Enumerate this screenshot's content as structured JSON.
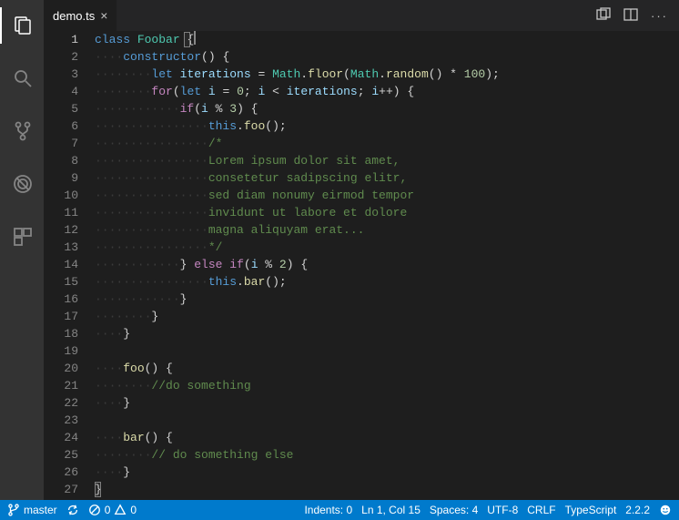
{
  "tabs": {
    "active": {
      "filename": "demo.ts"
    }
  },
  "code": {
    "lines": [
      [
        {
          "c": "kw",
          "t": "class"
        },
        {
          "c": "pln",
          "t": " "
        },
        {
          "c": "cls",
          "t": "Foobar"
        },
        {
          "c": "pln",
          "t": " {"
        }
      ],
      [
        {
          "c": "ws",
          "t": "····"
        },
        {
          "c": "kw",
          "t": "constructor"
        },
        {
          "c": "pln",
          "t": "() {"
        }
      ],
      [
        {
          "c": "ws",
          "t": "········"
        },
        {
          "c": "kw",
          "t": "let"
        },
        {
          "c": "pln",
          "t": " "
        },
        {
          "c": "ident",
          "t": "iterations"
        },
        {
          "c": "pln",
          "t": " = "
        },
        {
          "c": "cls",
          "t": "Math"
        },
        {
          "c": "pln",
          "t": "."
        },
        {
          "c": "fn",
          "t": "floor"
        },
        {
          "c": "pln",
          "t": "("
        },
        {
          "c": "cls",
          "t": "Math"
        },
        {
          "c": "pln",
          "t": "."
        },
        {
          "c": "fn",
          "t": "random"
        },
        {
          "c": "pln",
          "t": "() * "
        },
        {
          "c": "num",
          "t": "100"
        },
        {
          "c": "pln",
          "t": ");"
        }
      ],
      [
        {
          "c": "ws",
          "t": "········"
        },
        {
          "c": "kw2",
          "t": "for"
        },
        {
          "c": "pln",
          "t": "("
        },
        {
          "c": "kw",
          "t": "let"
        },
        {
          "c": "pln",
          "t": " "
        },
        {
          "c": "ident",
          "t": "i"
        },
        {
          "c": "pln",
          "t": " = "
        },
        {
          "c": "num",
          "t": "0"
        },
        {
          "c": "pln",
          "t": "; "
        },
        {
          "c": "ident",
          "t": "i"
        },
        {
          "c": "pln",
          "t": " < "
        },
        {
          "c": "ident",
          "t": "iterations"
        },
        {
          "c": "pln",
          "t": "; "
        },
        {
          "c": "ident",
          "t": "i"
        },
        {
          "c": "pln",
          "t": "++) {"
        }
      ],
      [
        {
          "c": "ws",
          "t": "············"
        },
        {
          "c": "kw2",
          "t": "if"
        },
        {
          "c": "pln",
          "t": "("
        },
        {
          "c": "ident",
          "t": "i"
        },
        {
          "c": "pln",
          "t": " % "
        },
        {
          "c": "num",
          "t": "3"
        },
        {
          "c": "pln",
          "t": ") {"
        }
      ],
      [
        {
          "c": "ws",
          "t": "················"
        },
        {
          "c": "tok-this",
          "t": "this"
        },
        {
          "c": "pln",
          "t": "."
        },
        {
          "c": "fn",
          "t": "foo"
        },
        {
          "c": "pln",
          "t": "();"
        }
      ],
      [
        {
          "c": "ws",
          "t": "················"
        },
        {
          "c": "cmt",
          "t": "/*"
        }
      ],
      [
        {
          "c": "ws",
          "t": "················"
        },
        {
          "c": "cmt",
          "t": "Lorem ipsum dolor sit amet,"
        }
      ],
      [
        {
          "c": "ws",
          "t": "················"
        },
        {
          "c": "cmt",
          "t": "consetetur sadipscing elitr,"
        }
      ],
      [
        {
          "c": "ws",
          "t": "················"
        },
        {
          "c": "cmt",
          "t": "sed diam nonumy eirmod tempor"
        }
      ],
      [
        {
          "c": "ws",
          "t": "················"
        },
        {
          "c": "cmt",
          "t": "invidunt ut labore et dolore"
        }
      ],
      [
        {
          "c": "ws",
          "t": "················"
        },
        {
          "c": "cmt",
          "t": "magna aliquyam erat..."
        }
      ],
      [
        {
          "c": "ws",
          "t": "················"
        },
        {
          "c": "cmt",
          "t": "*/"
        }
      ],
      [
        {
          "c": "ws",
          "t": "············"
        },
        {
          "c": "pln",
          "t": "} "
        },
        {
          "c": "kw2",
          "t": "else"
        },
        {
          "c": "pln",
          "t": " "
        },
        {
          "c": "kw2",
          "t": "if"
        },
        {
          "c": "pln",
          "t": "("
        },
        {
          "c": "ident",
          "t": "i"
        },
        {
          "c": "pln",
          "t": " % "
        },
        {
          "c": "num",
          "t": "2"
        },
        {
          "c": "pln",
          "t": ") {"
        }
      ],
      [
        {
          "c": "ws",
          "t": "················"
        },
        {
          "c": "tok-this",
          "t": "this"
        },
        {
          "c": "pln",
          "t": "."
        },
        {
          "c": "fn",
          "t": "bar"
        },
        {
          "c": "pln",
          "t": "();"
        }
      ],
      [
        {
          "c": "ws",
          "t": "············"
        },
        {
          "c": "pln",
          "t": "}"
        }
      ],
      [
        {
          "c": "ws",
          "t": "········"
        },
        {
          "c": "pln",
          "t": "}"
        }
      ],
      [
        {
          "c": "ws",
          "t": "····"
        },
        {
          "c": "pln",
          "t": "}"
        }
      ],
      [],
      [
        {
          "c": "ws",
          "t": "····"
        },
        {
          "c": "fn",
          "t": "foo"
        },
        {
          "c": "pln",
          "t": "() {"
        }
      ],
      [
        {
          "c": "ws",
          "t": "········"
        },
        {
          "c": "cmt",
          "t": "//do something"
        }
      ],
      [
        {
          "c": "ws",
          "t": "····"
        },
        {
          "c": "pln",
          "t": "}"
        }
      ],
      [],
      [
        {
          "c": "ws",
          "t": "····"
        },
        {
          "c": "fn",
          "t": "bar"
        },
        {
          "c": "pln",
          "t": "() {"
        }
      ],
      [
        {
          "c": "ws",
          "t": "········"
        },
        {
          "c": "cmt",
          "t": "// do something else"
        }
      ],
      [
        {
          "c": "ws",
          "t": "····"
        },
        {
          "c": "pln",
          "t": "}"
        }
      ],
      [
        {
          "c": "pln",
          "t": "}"
        }
      ]
    ],
    "current_line": 1
  },
  "statusbar": {
    "branch": "master",
    "errors": "0",
    "warnings": "0",
    "indents": "Indents: 0",
    "position": "Ln 1, Col 15",
    "spaces": "Spaces: 4",
    "encoding": "UTF-8",
    "eol": "CRLF",
    "language": "TypeScript",
    "version": "2.2.2"
  }
}
